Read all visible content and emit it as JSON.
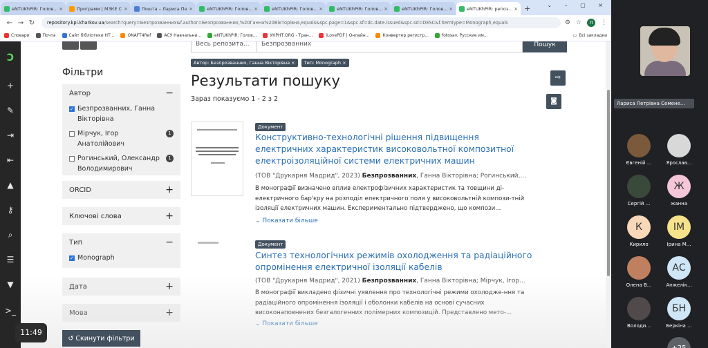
{
  "browser": {
    "tabs": [
      {
        "label": "eNTUKhPIR: Голов...",
        "icon": "green"
      },
      {
        "label": "Програми | МЗКЕ С...",
        "icon": "orange"
      },
      {
        "label": "Пошта – Лариса Пет...",
        "icon": "blue"
      },
      {
        "label": "eNTUKhPIR: Голов...",
        "icon": "green"
      },
      {
        "label": "eNTUKhPIR: Голов...",
        "icon": "green"
      },
      {
        "label": "eNTUKhPIR: Голов...",
        "icon": "green"
      },
      {
        "label": "eNTUKhPIR: Голов...",
        "icon": "green"
      },
      {
        "label": "eNTUKhPIR: репоз...",
        "icon": "green",
        "active": true
      }
    ],
    "url_domain": "repository.kpi.kharkov.ua",
    "url_rest": "/search?query=Безпрозванних&f.author=Безпрозванних,%20Ганна%20Вікторівна,equals&spc.page=1&spc.sf=dc.date.issued&spc.sd=DESC&f.itemtype=Monograph,equals",
    "bookmarks": [
      "Словари",
      "Почта",
      "Сайт бібліотеки НТ...",
      "ONAFT4Ref",
      "АСУ Навчальни...",
      "eNTUKhPIR: Голов...",
      "УКРНТ.ORG - Тран...",
      "iLovePDF | Онлайн...",
      "Конвертер регистр...",
      "fotosav. Русские им..."
    ],
    "bookmarks_right": "Всі закладки"
  },
  "clock": "11:49",
  "search": {
    "scope": "Весь репозита...",
    "query": "Безпрозванних",
    "button": "Пошук"
  },
  "filters": {
    "title": "Фільтри",
    "author": {
      "label": "Автор",
      "items": [
        {
          "name": "Безпрозванних, Ганна Вікторівна",
          "checked": true,
          "count": ""
        },
        {
          "name": "Мірчук, Ігор Анатолійович",
          "checked": false,
          "count": "1"
        },
        {
          "name": "Рогинський, Олександр Володимирович",
          "checked": false,
          "count": "1"
        }
      ]
    },
    "orcid": "ORCID",
    "keywords": "Ключові слова",
    "type": {
      "label": "Тип",
      "item": "Monograph"
    },
    "date": "Дата",
    "language": "Мова",
    "reset": "Скинути фільтри"
  },
  "active_filters": [
    "Автор: Безпрозванних, Ганна Вікторівна ×",
    "Тип: Monograph ×"
  ],
  "results": {
    "title": "Результати пошуку",
    "shown": "Зараз показуємо 1 - 2 з 2",
    "items": [
      {
        "badge": "Документ",
        "title": "Конструктивно-технологічні рішення підвищення електричних характеристик високовольтної композитної електроізоляційної системи електричних машин",
        "publisher": "(ТОВ \"Друкарня Мадрид\", 2023)",
        "authors_bold": "Безпрозванних",
        "authors_rest": ", Ганна Вікторівна; Рогинський,...",
        "abstract": "В монографії визначено вплив електрофізичних характеристик та товщини ді-електричного бар'єру на розподіл електричного поля у високовольтній компози-тній ізоляції електричних машин. Експериментально підтверджено, що компози...",
        "more": "Показати більше"
      },
      {
        "badge": "Документ",
        "title": "Синтез технологічних режимів охолодження та радіаційного опромінення електричної ізоляції кабелів",
        "publisher": "(ТОВ \"Друкарня Мадрид\", 2021)",
        "authors_bold": "Безпрозванних",
        "authors_rest": ", Ганна Вікторівна; Мірчук, Ігор...",
        "abstract": "В монографії викладено фізичні уявлення про технологічні режими охолодже-ння та радіаційного опромінення ізоляції і оболонки кабелів на основі сучасних високонаповнених безгалогенних полімерних композицій. Представлено мето-...",
        "more": "Показати більше"
      }
    ]
  },
  "call": {
    "self_name": "Лариса Петрівна Семене...",
    "participants": [
      {
        "label": "Євгеній ...",
        "avatar": "photo",
        "color": "#7a5a3a"
      },
      {
        "label": "Ярослав...",
        "avatar": "photo",
        "color": "#d8d8d8"
      },
      {
        "label": "Сергій ...",
        "avatar": "photo",
        "color": "#3a4a3a"
      },
      {
        "label": "жанна",
        "avatar": "Ж",
        "color": "#f4c6d8"
      },
      {
        "label": "Кирило",
        "avatar": "К",
        "color": "#f8d8b8"
      },
      {
        "label": "Ірина М...",
        "avatar": "ІМ",
        "color": "#f6e28a"
      },
      {
        "label": "Олена В...",
        "avatar": "photo",
        "color": "#c08060"
      },
      {
        "label": "Анжелік...",
        "avatar": "АС",
        "color": "#cfe6f7"
      },
      {
        "label": "Володи...",
        "avatar": "photo",
        "color": "#504a4a"
      },
      {
        "label": "Беркіна ...",
        "avatar": "БН",
        "color": "#cfe6f7"
      }
    ],
    "more_count": "+25"
  }
}
